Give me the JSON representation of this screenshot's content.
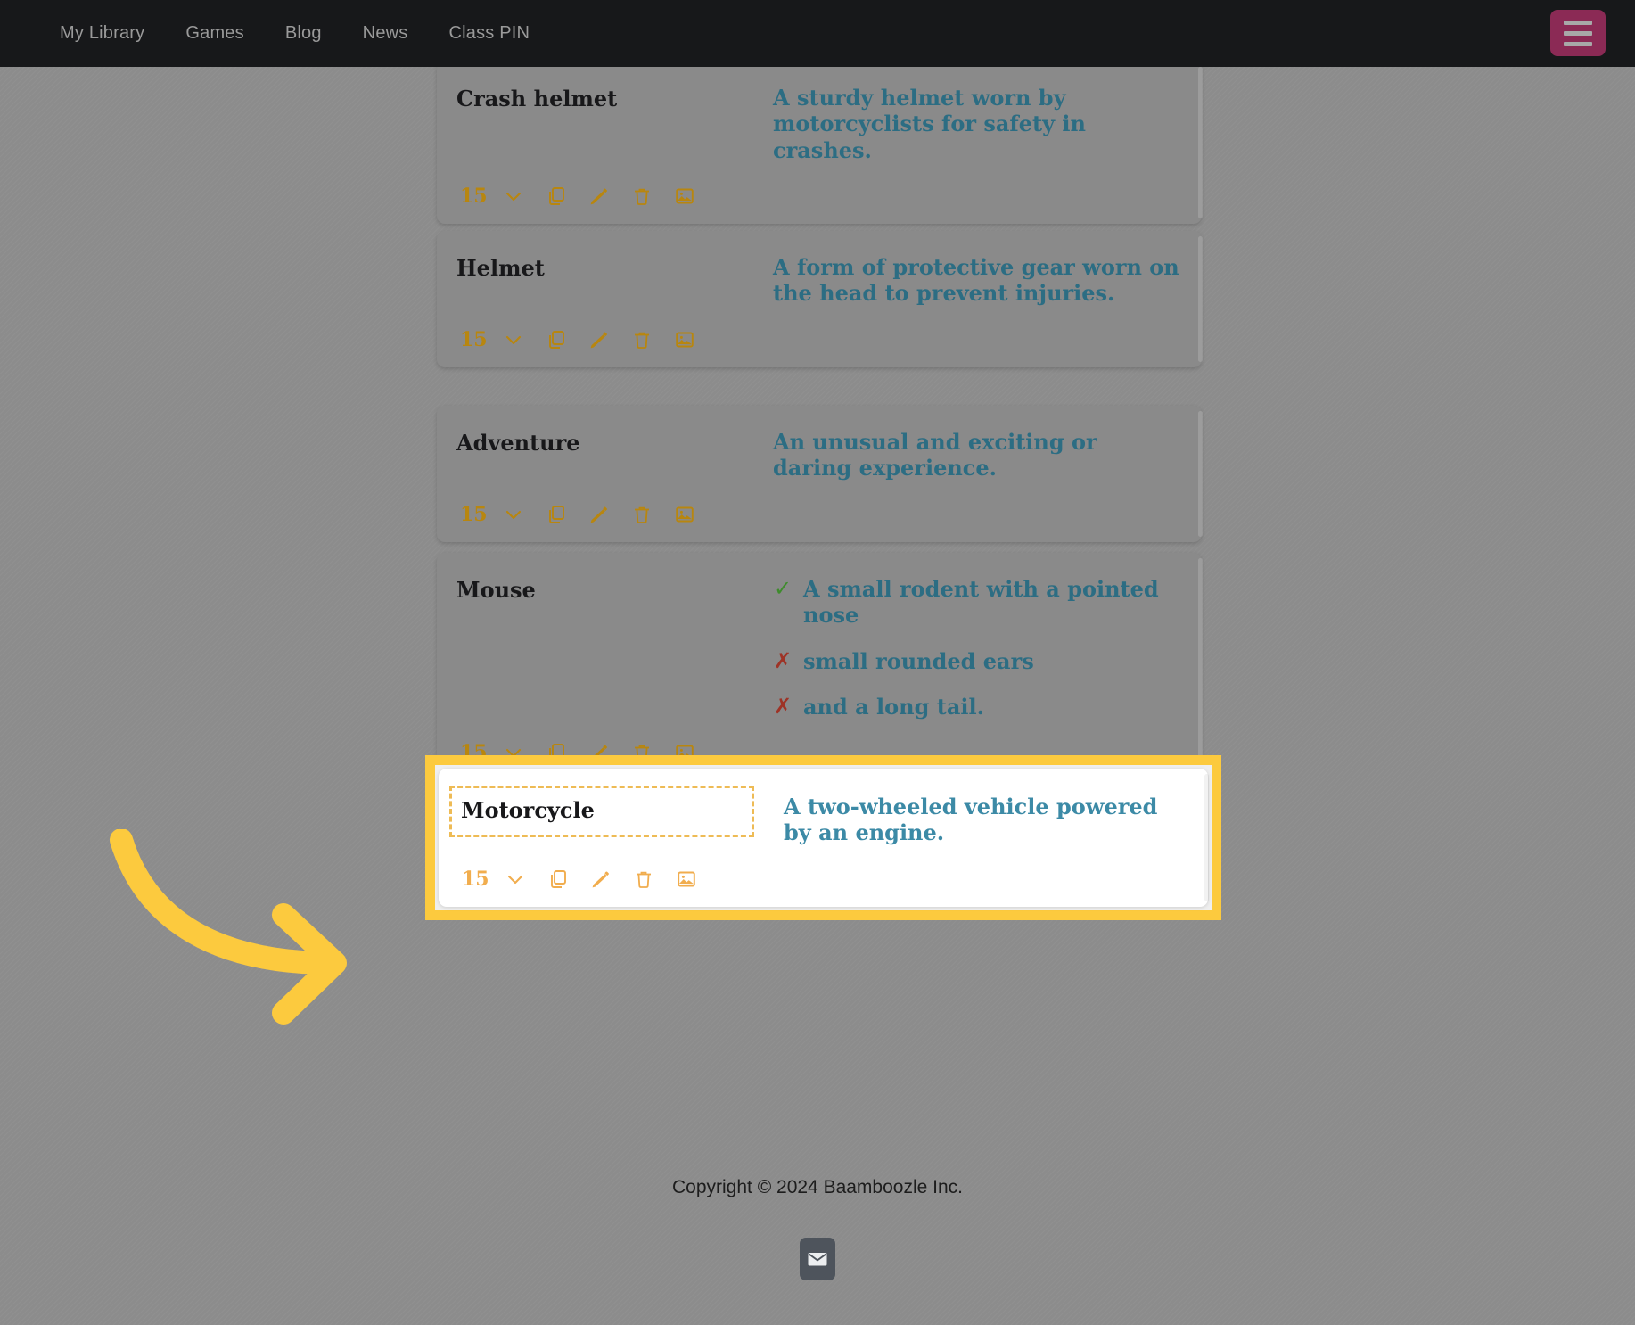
{
  "navbar": {
    "links": [
      {
        "label": "My Library"
      },
      {
        "label": "Games"
      },
      {
        "label": "Blog"
      },
      {
        "label": "News"
      },
      {
        "label": "Class PIN"
      }
    ],
    "menu_button_icon": "hamburger-icon"
  },
  "colors": {
    "page_dim": "#8c8c8c",
    "navbar": "#17181a",
    "menu_button": "#8b2a55",
    "card": "#8a8a8a",
    "card_title_text": "#18181a",
    "card_desc_text": "#2c6d83",
    "toolbar_icon": "#b8860f",
    "highlight_border": "#FCCA3E",
    "highlight_card_bg": "#ffffff",
    "highlight_icon": "#f1ad4e",
    "dashed_edit_border": "#eebb55",
    "check_green": "#3e8c2c",
    "cross_red": "#9e3326",
    "arrow": "#FCCA3E",
    "email_button": "#4e545c"
  },
  "toolbar": {
    "count": "15",
    "icons": [
      {
        "name": "chevron-down-icon",
        "label": "Expand"
      },
      {
        "name": "copy-icon",
        "label": "Duplicate"
      },
      {
        "name": "pencil-icon",
        "label": "Edit"
      },
      {
        "name": "trash-icon",
        "label": "Delete"
      },
      {
        "name": "image-icon",
        "label": "Add image"
      }
    ]
  },
  "cards": [
    {
      "title": "Crash helmet",
      "desc": "A sturdy helmet worn by motorcyclists for safety in crashes.",
      "count": "15",
      "highlighted": false
    },
    {
      "title": "Helmet",
      "desc": "A form of protective gear worn on the head to prevent injuries.",
      "count": "15",
      "highlighted": false
    },
    {
      "title": "Adventure",
      "desc": "An unusual and exciting or daring experience.",
      "count": "15",
      "highlighted": false
    },
    {
      "title": "Mouse",
      "count": "15",
      "highlighted": false,
      "bullets": [
        {
          "mark": "check",
          "text": "A small rodent with a pointed nose"
        },
        {
          "mark": "cross",
          "text": "small rounded ears"
        },
        {
          "mark": "cross",
          "text": "and a long tail."
        }
      ]
    }
  ],
  "highlighted_card": {
    "title": "Motorcycle",
    "desc": "A two-wheeled vehicle powered by an engine.",
    "count": "15",
    "title_editable": true
  },
  "annotation": {
    "arrow_icon": "curved-arrow-right-icon",
    "points_to": "Motorcycle"
  },
  "footer": {
    "copyright": "Copyright © 2024 Baamboozle Inc.",
    "email_icon": "envelope-icon"
  }
}
